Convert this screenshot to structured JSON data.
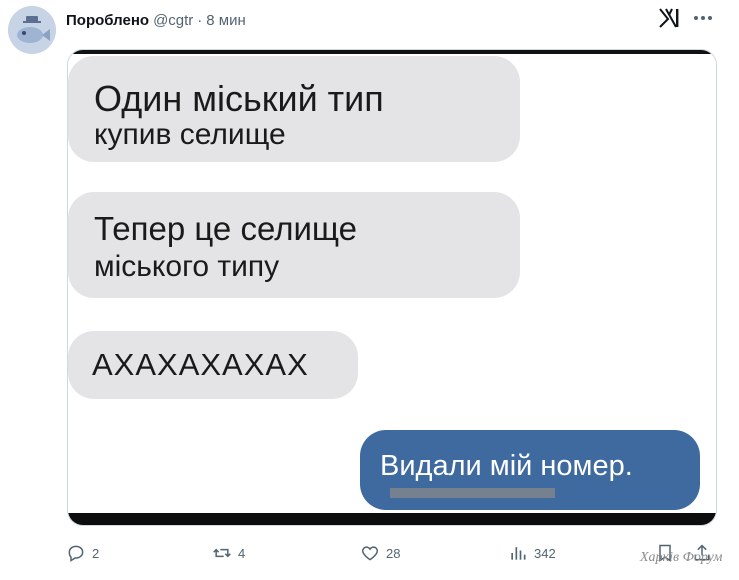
{
  "tweet": {
    "author_name": "Пороблено",
    "handle": "@cgtr",
    "separator": "·",
    "time": "8 мин"
  },
  "media": {
    "messages": [
      {
        "lines": [
          "Один міський тип",
          "купив селище"
        ],
        "side": "left"
      },
      {
        "lines": [
          "Тепер це селище",
          "міського типу"
        ],
        "side": "left"
      },
      {
        "lines": [
          "АХАХАХАХАХ"
        ],
        "side": "left"
      },
      {
        "lines": [
          "Видали мій номер."
        ],
        "side": "right"
      }
    ]
  },
  "actions": {
    "reply_count": "2",
    "retweet_count": "4",
    "like_count": "28",
    "views_count": "342"
  },
  "icons": {
    "reply": "reply-icon",
    "retweet": "retweet-icon",
    "like": "heart-icon",
    "views": "views-icon",
    "bookmark": "bookmark-icon",
    "share": "share-icon",
    "more": "more-icon",
    "logo": "x-logo-icon"
  },
  "watermark": "Харків Форум",
  "colors": {
    "bubble_gray": "#e4e4e6",
    "bubble_blue": "#3f6aa0",
    "muted_text": "#536471"
  }
}
